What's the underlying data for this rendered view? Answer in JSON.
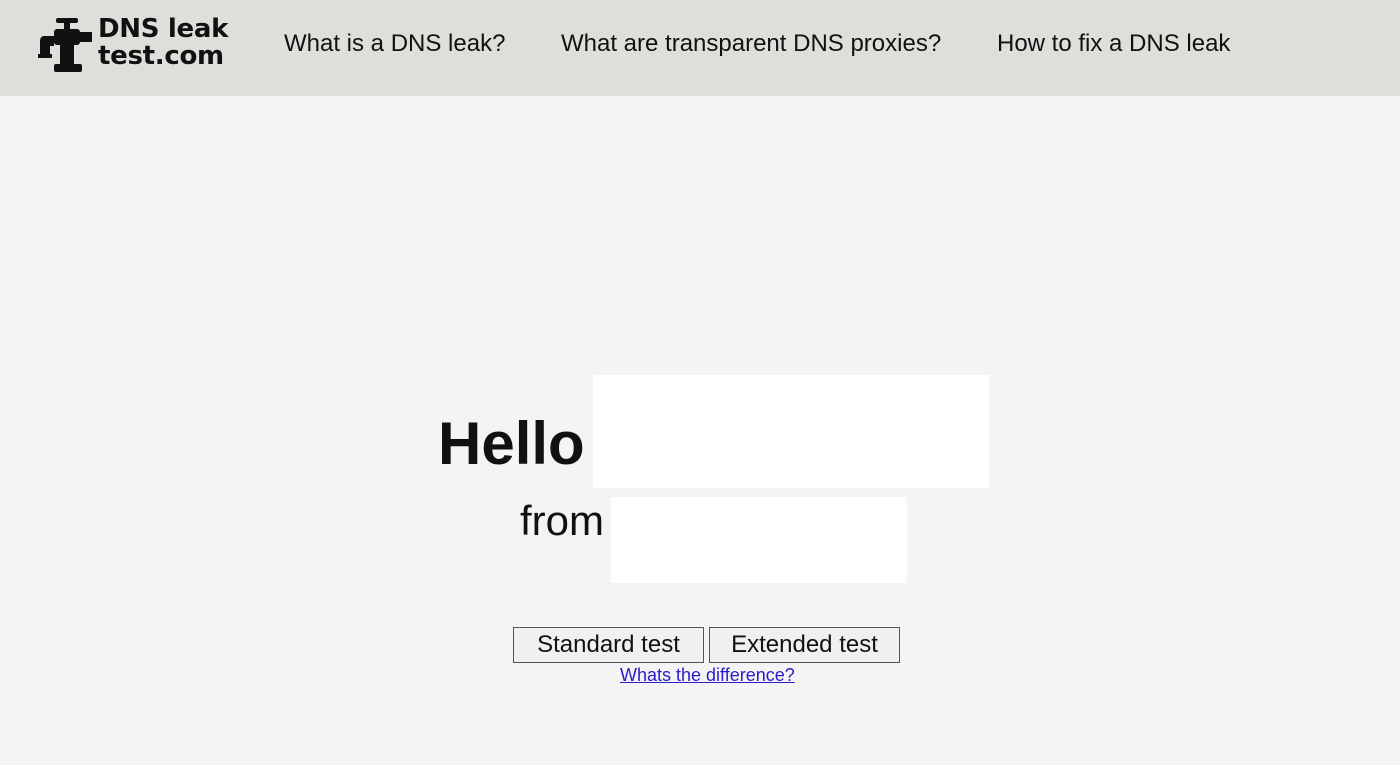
{
  "header": {
    "logo": {
      "line1": "DNS leak",
      "line2": "test.com",
      "icon": "tap-icon"
    },
    "nav": [
      {
        "label": "What is a DNS leak?"
      },
      {
        "label": "What are transparent DNS proxies?"
      },
      {
        "label": "How to fix a DNS leak"
      }
    ]
  },
  "main": {
    "greeting": "Hello",
    "ip_value": "",
    "from_label": "from",
    "location_value": "",
    "buttons": {
      "standard": "Standard test",
      "extended": "Extended test"
    },
    "difference_link": "Whats the difference?"
  },
  "colors": {
    "header_bg": "#dfdeda",
    "page_bg": "#f4f4f4",
    "link": "#2a1cc9"
  }
}
